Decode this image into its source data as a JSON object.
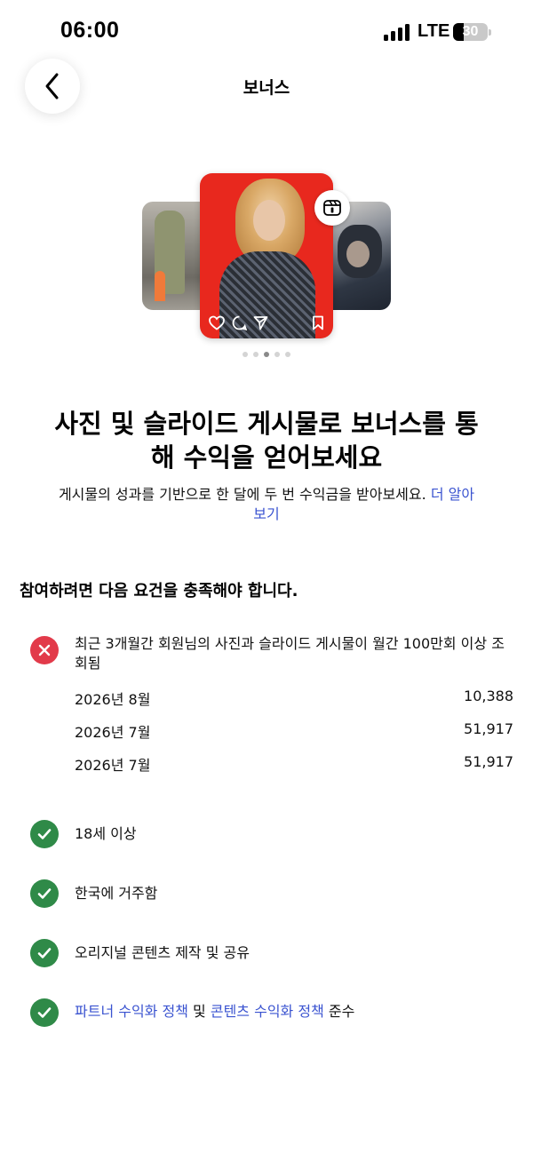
{
  "status_bar": {
    "time": "06:00",
    "network": "LTE",
    "battery_level": "30"
  },
  "header": {
    "title": "보너스"
  },
  "carousel": {
    "dot_count": 5,
    "active_index": 2
  },
  "hero": {
    "headline_line1": "사진 및 슬라이드 게시물로 보너스를 통",
    "headline_line2": "해 수익을 얻어보세요",
    "description": "게시물의 성과를 기반으로 한 달에 두 번 수익금을 받아보세요.",
    "learn_more_link": "더 알아보기"
  },
  "requirements": {
    "title": "참여하려면 다음 요건을 충족해야 합니다.",
    "views": {
      "status": "fail",
      "text": "최근 3개월간 회원님의 사진과 슬라이드 게시물이 월간 100만회 이상 조회됨",
      "stats": [
        {
          "month": "2026년 8월",
          "views": "10,388"
        },
        {
          "month": "2026년 7월",
          "views": "51,917"
        },
        {
          "month": "2026년 7월",
          "views": "51,917"
        }
      ]
    },
    "age": {
      "status": "pass",
      "text": "18세 이상"
    },
    "residence": {
      "status": "pass",
      "text": "한국에 거주함"
    },
    "original": {
      "status": "pass",
      "text": "오리지널 콘텐츠 제작 및 공유"
    },
    "policy": {
      "status": "pass",
      "partner_policy_link": "파트너 수익화 정책",
      "conjunction": "및",
      "content_policy_link": "콘텐츠 수익화 정책",
      "suffix": "준수"
    }
  },
  "colors": {
    "link": "#3a53d0",
    "fail": "#e23a4a",
    "pass": "#2f8a48",
    "card_accent": "#e8281e"
  },
  "icons": [
    "back-chevron-icon",
    "reels-icon",
    "heart-icon",
    "comment-icon",
    "share-icon",
    "bookmark-icon",
    "x-icon",
    "check-icon"
  ]
}
